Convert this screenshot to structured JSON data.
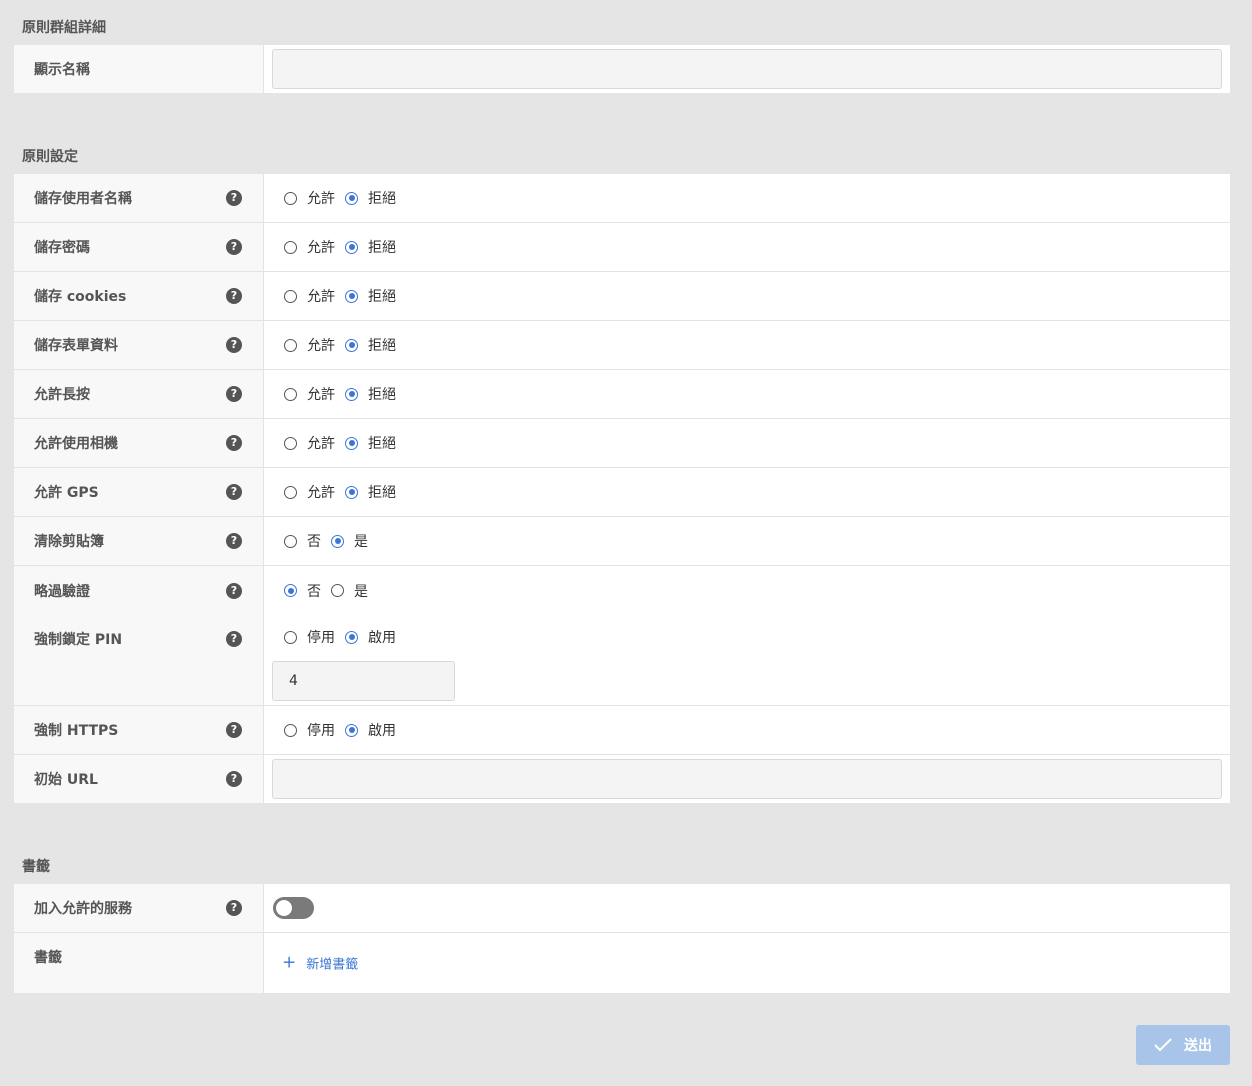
{
  "group_section": {
    "title": "原則群組詳細",
    "display_name_label": "顯示名稱",
    "display_name_value": ""
  },
  "policy_section": {
    "title": "原則設定",
    "rows": [
      {
        "label": "儲存使用者名稱",
        "options": [
          "允許",
          "拒絕"
        ],
        "selected": 1
      },
      {
        "label": "儲存密碼",
        "options": [
          "允許",
          "拒絕"
        ],
        "selected": 1
      },
      {
        "label": "儲存 cookies",
        "options": [
          "允許",
          "拒絕"
        ],
        "selected": 1
      },
      {
        "label": "儲存表單資料",
        "options": [
          "允許",
          "拒絕"
        ],
        "selected": 1
      },
      {
        "label": "允許長按",
        "options": [
          "允許",
          "拒絕"
        ],
        "selected": 1
      },
      {
        "label": "允許使用相機",
        "options": [
          "允許",
          "拒絕"
        ],
        "selected": 1
      },
      {
        "label": "允許 GPS",
        "options": [
          "允許",
          "拒絕"
        ],
        "selected": 1
      },
      {
        "label": "清除剪貼簿",
        "options": [
          "否",
          "是"
        ],
        "selected": 1
      },
      {
        "label": "略過驗證",
        "options": [
          "否",
          "是"
        ],
        "selected": 0
      }
    ],
    "pin_row": {
      "label": "強制鎖定 PIN",
      "options": [
        "停用",
        "啟用"
      ],
      "selected": 1,
      "pin_value": "4"
    },
    "https_row": {
      "label": "強制 HTTPS",
      "options": [
        "停用",
        "啟用"
      ],
      "selected": 1
    },
    "url_row": {
      "label": "初始 URL",
      "value": ""
    }
  },
  "bookmark_section": {
    "title": "書籤",
    "allowed_services_label": "加入允許的服務",
    "allowed_services_on": false,
    "bookmarks_label": "書籤",
    "add_bookmark_label": "新增書籤"
  },
  "submit_label": "送出",
  "help_glyph": "?",
  "accent_color": "#3b76d6"
}
